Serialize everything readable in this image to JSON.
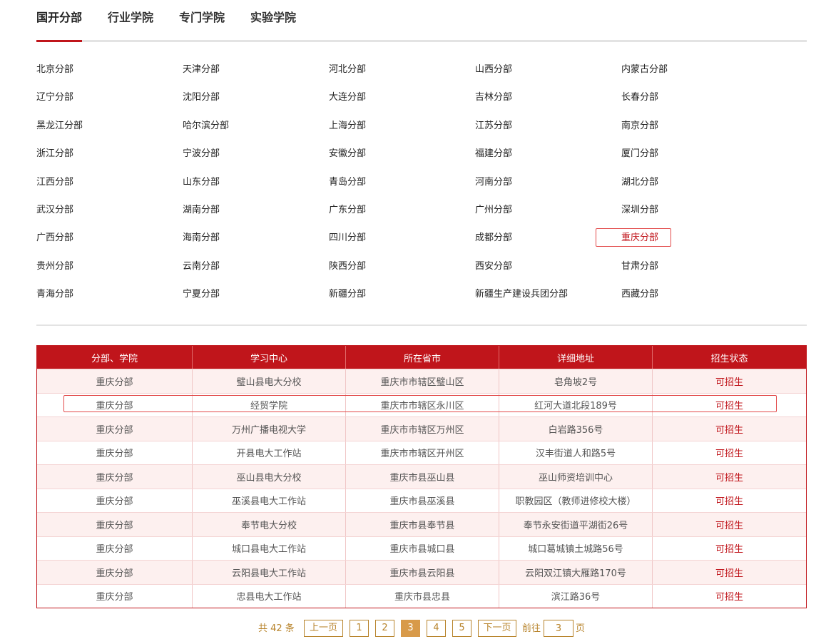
{
  "tabs": [
    "国开分部",
    "行业学院",
    "专门学院",
    "实验学院"
  ],
  "branches": [
    [
      "北京分部",
      "天津分部",
      "河北分部",
      "山西分部",
      "内蒙古分部"
    ],
    [
      "辽宁分部",
      "沈阳分部",
      "大连分部",
      "吉林分部",
      "长春分部"
    ],
    [
      "黑龙江分部",
      "哈尔滨分部",
      "上海分部",
      "江苏分部",
      "南京分部"
    ],
    [
      "浙江分部",
      "宁波分部",
      "安徽分部",
      "福建分部",
      "厦门分部"
    ],
    [
      "江西分部",
      "山东分部",
      "青岛分部",
      "河南分部",
      "湖北分部"
    ],
    [
      "武汉分部",
      "湖南分部",
      "广东分部",
      "广州分部",
      "深圳分部"
    ],
    [
      "广西分部",
      "海南分部",
      "四川分部",
      "成都分部",
      "重庆分部"
    ],
    [
      "贵州分部",
      "云南分部",
      "陕西分部",
      "西安分部",
      "甘肃分部"
    ],
    [
      "青海分部",
      "宁夏分部",
      "新疆分部",
      "新疆生产建设兵团分部",
      "西藏分部"
    ]
  ],
  "selected_branch": "重庆分部",
  "table": {
    "headers": [
      "分部、学院",
      "学习中心",
      "所在省市",
      "详细地址",
      "招生状态"
    ],
    "rows": [
      [
        "重庆分部",
        "璧山县电大分校",
        "重庆市市辖区璧山区",
        "皂角坡2号",
        "可招生"
      ],
      [
        "重庆分部",
        "经贸学院",
        "重庆市市辖区永川区",
        "红河大道北段189号",
        "可招生"
      ],
      [
        "重庆分部",
        "万州广播电视大学",
        "重庆市市辖区万州区",
        "白岩路356号",
        "可招生"
      ],
      [
        "重庆分部",
        "开县电大工作站",
        "重庆市市辖区开州区",
        "汉丰街道人和路5号",
        "可招生"
      ],
      [
        "重庆分部",
        "巫山县电大分校",
        "重庆市县巫山县",
        "巫山师资培训中心",
        "可招生"
      ],
      [
        "重庆分部",
        "巫溪县电大工作站",
        "重庆市县巫溪县",
        "职教园区（教师进修校大楼）",
        "可招生"
      ],
      [
        "重庆分部",
        "奉节电大分校",
        "重庆市县奉节县",
        "奉节永安街道平湖街26号",
        "可招生"
      ],
      [
        "重庆分部",
        "城口县电大工作站",
        "重庆市县城口县",
        "城口葛城镇土城路56号",
        "可招生"
      ],
      [
        "重庆分部",
        "云阳县电大工作站",
        "重庆市县云阳县",
        "云阳双江镇大雁路170号",
        "可招生"
      ],
      [
        "重庆分部",
        "忠县电大工作站",
        "重庆市县忠县",
        "滨江路36号",
        "可招生"
      ]
    ]
  },
  "pager": {
    "total": "共 42 条",
    "prev": "上一页",
    "pages": [
      "1",
      "2",
      "3",
      "4",
      "5"
    ],
    "current": "3",
    "next": "下一页",
    "goto_prefix": "前往",
    "goto_value": "3",
    "goto_suffix": "页"
  },
  "colors": {
    "accent": "#c0151b",
    "pager": "#b8842c",
    "pager_current": "#d89a4a"
  }
}
